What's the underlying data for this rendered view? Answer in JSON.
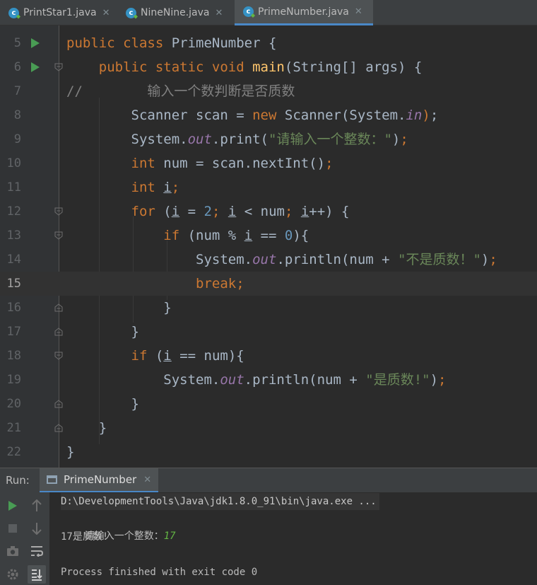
{
  "tabs": [
    {
      "label": "PrintStar1.java",
      "active": false
    },
    {
      "label": "NineNine.java",
      "active": false
    },
    {
      "label": "PrimeNumber.java",
      "active": true
    }
  ],
  "editor": {
    "current_line": 15,
    "line_numbers": [
      "5",
      "6",
      "7",
      "8",
      "9",
      "10",
      "11",
      "12",
      "13",
      "14",
      "15",
      "16",
      "17",
      "18",
      "19",
      "20",
      "21",
      "22"
    ]
  },
  "code_strings": {
    "comment": "//        输入一个数判断是否质数",
    "prompt": "\"请输入一个整数：\"",
    "not_prime": "\"不是质数！\"",
    "is_prime": "\"是质数!\""
  },
  "run_panel": {
    "label": "Run:",
    "tab_label": "PrimeNumber",
    "command_line": "D:\\DevelopmentTools\\Java\\jdk1.8.0_91\\bin\\java.exe ...",
    "prompt_output": "请输入一个整数：",
    "user_input": "17",
    "result_output": "17是质数!",
    "exit_message": "Process finished with exit code 0"
  },
  "colors": {
    "keyword": "#cc7832",
    "string": "#6a8759",
    "number": "#6897bb",
    "method": "#ffc66d",
    "static_field": "#9876aa",
    "comment": "#808080",
    "run_green": "#499c54"
  },
  "icons": [
    "java-class-icon",
    "run-gutter-icon",
    "fold-icon",
    "close-icon",
    "run-icon",
    "stop-icon",
    "camera-icon",
    "settings-icon",
    "up-arrow-icon",
    "down-arrow-icon",
    "soft-wrap-icon",
    "scroll-to-end-icon"
  ]
}
